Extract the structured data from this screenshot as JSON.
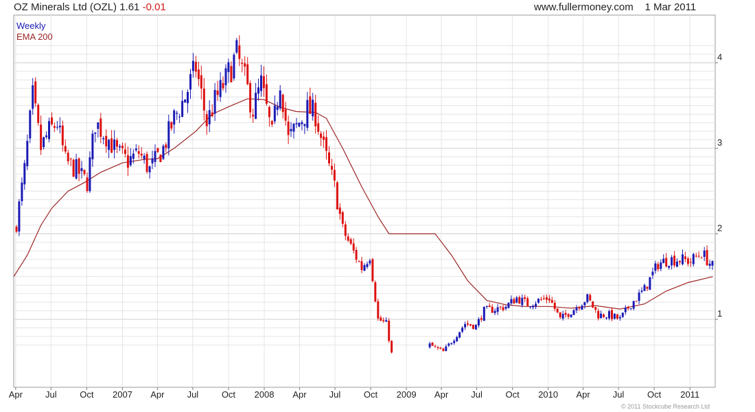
{
  "header": {
    "title": "OZ Minerals Ltd (OZL)",
    "price": "1.61",
    "change": "-0.01",
    "site": "www.fullermoney.com",
    "date": "1 Mar 2011"
  },
  "copyright": "© 2011 Stockcube Research Ltd",
  "colors": {
    "up": "#1a1ab4",
    "down": "#dd1111",
    "ema": "#9c2424",
    "grid": "#e4e4e4"
  },
  "chart_data": {
    "type": "candlestick",
    "interval": "Weekly",
    "series": [
      {
        "name": "Weekly",
        "kind": "candlestick",
        "anchors": [
          [
            "2006-04-03",
            2.12
          ],
          [
            "2006-04-24",
            2.75
          ],
          [
            "2006-05-15",
            3.6
          ],
          [
            "2006-06-05",
            3.0
          ],
          [
            "2006-06-26",
            3.2
          ],
          [
            "2006-07-17",
            3.3
          ],
          [
            "2006-08-07",
            2.85
          ],
          [
            "2006-09-04",
            2.75
          ],
          [
            "2006-10-02",
            2.6
          ],
          [
            "2006-10-23",
            3.3
          ],
          [
            "2006-11-20",
            3.15
          ],
          [
            "2006-12-18",
            2.95
          ],
          [
            "2007-01-15",
            2.85
          ],
          [
            "2007-02-12",
            2.95
          ],
          [
            "2007-03-12",
            2.75
          ],
          [
            "2007-04-16",
            3.0
          ],
          [
            "2007-05-14",
            3.35
          ],
          [
            "2007-06-11",
            3.6
          ],
          [
            "2007-07-09",
            3.95
          ],
          [
            "2007-08-06",
            3.3
          ],
          [
            "2007-08-27",
            3.55
          ],
          [
            "2007-09-24",
            3.8
          ],
          [
            "2007-10-22",
            4.1
          ],
          [
            "2007-11-12",
            3.8
          ],
          [
            "2007-12-03",
            3.45
          ],
          [
            "2007-12-24",
            3.75
          ],
          [
            "2008-01-21",
            3.15
          ],
          [
            "2008-02-11",
            3.8
          ],
          [
            "2008-03-03",
            3.1
          ],
          [
            "2008-03-24",
            3.25
          ],
          [
            "2008-04-21",
            3.45
          ],
          [
            "2008-05-12",
            3.4
          ],
          [
            "2008-06-02",
            3.0
          ],
          [
            "2008-06-30",
            2.55
          ],
          [
            "2008-07-21",
            2.05
          ],
          [
            "2008-08-11",
            1.85
          ],
          [
            "2008-09-08",
            1.6
          ],
          [
            "2008-09-29",
            1.75
          ],
          [
            "2008-10-20",
            1.0
          ],
          [
            "2008-11-10",
            0.95
          ],
          [
            "2008-11-24",
            0.6
          ]
        ]
      },
      {
        "name": "Weekly",
        "kind": "candlestick",
        "anchors": [
          [
            "2009-03-02",
            0.7
          ],
          [
            "2009-04-06",
            0.62
          ],
          [
            "2009-05-04",
            0.78
          ],
          [
            "2009-06-01",
            0.95
          ],
          [
            "2009-06-29",
            0.92
          ],
          [
            "2009-07-20",
            1.1
          ],
          [
            "2009-08-17",
            1.12
          ],
          [
            "2009-09-14",
            1.15
          ],
          [
            "2009-10-12",
            1.25
          ],
          [
            "2009-11-09",
            1.18
          ],
          [
            "2009-12-07",
            1.22
          ],
          [
            "2010-01-04",
            1.25
          ],
          [
            "2010-02-01",
            1.0
          ],
          [
            "2010-03-08",
            1.12
          ],
          [
            "2010-04-12",
            1.25
          ],
          [
            "2010-05-10",
            1.05
          ],
          [
            "2010-06-07",
            1.05
          ],
          [
            "2010-07-05",
            1.0
          ],
          [
            "2010-08-02",
            1.18
          ],
          [
            "2010-09-06",
            1.35
          ],
          [
            "2010-10-11",
            1.65
          ],
          [
            "2010-11-08",
            1.7
          ],
          [
            "2010-12-06",
            1.7
          ],
          [
            "2011-01-03",
            1.68
          ],
          [
            "2011-01-31",
            1.78
          ],
          [
            "2011-03-01",
            1.61
          ]
        ]
      },
      {
        "name": "EMA 200",
        "kind": "line",
        "anchors": [
          [
            "2006-03-27",
            1.5
          ],
          [
            "2006-05-01",
            1.75
          ],
          [
            "2006-06-05",
            2.1
          ],
          [
            "2006-07-03",
            2.3
          ],
          [
            "2006-08-14",
            2.5
          ],
          [
            "2006-09-25",
            2.6
          ],
          [
            "2006-11-06",
            2.72
          ],
          [
            "2007-01-01",
            2.83
          ],
          [
            "2007-02-26",
            2.87
          ],
          [
            "2007-04-02",
            2.88
          ],
          [
            "2007-05-14",
            3.0
          ],
          [
            "2007-07-09",
            3.2
          ],
          [
            "2007-08-20",
            3.4
          ],
          [
            "2007-10-08",
            3.5
          ],
          [
            "2007-11-19",
            3.58
          ],
          [
            "2007-12-31",
            3.57
          ],
          [
            "2008-02-11",
            3.48
          ],
          [
            "2008-03-24",
            3.43
          ],
          [
            "2008-05-12",
            3.42
          ],
          [
            "2008-06-09",
            3.35
          ],
          [
            "2008-07-21",
            3.0
          ],
          [
            "2008-09-08",
            2.55
          ],
          [
            "2008-10-20",
            2.2
          ],
          [
            "2008-11-17",
            2.0
          ],
          [
            "2009-03-16",
            2.0
          ],
          [
            "2009-04-27",
            1.75
          ],
          [
            "2009-06-08",
            1.45
          ],
          [
            "2009-07-27",
            1.22
          ],
          [
            "2009-09-14",
            1.17
          ],
          [
            "2009-11-02",
            1.15
          ],
          [
            "2010-01-04",
            1.15
          ],
          [
            "2010-03-01",
            1.13
          ],
          [
            "2010-05-03",
            1.16
          ],
          [
            "2010-07-05",
            1.12
          ],
          [
            "2010-09-06",
            1.18
          ],
          [
            "2010-11-01",
            1.33
          ],
          [
            "2010-12-27",
            1.43
          ],
          [
            "2011-03-01",
            1.5
          ]
        ]
      }
    ],
    "legend": [
      "Weekly",
      "EMA 200"
    ],
    "legend_position": "top-left",
    "yaxis_side": "right",
    "ylim": [
      0.6,
      4.3
    ],
    "y_ticks": [
      1,
      2,
      3,
      4
    ],
    "xlim": [
      "2006-03-27",
      "2011-03-07"
    ],
    "x_ticks": [
      [
        "2006-04-01",
        "Apr"
      ],
      [
        "2006-07-01",
        "Jul"
      ],
      [
        "2006-10-01",
        "Oct"
      ],
      [
        "2007-01-01",
        "2007"
      ],
      [
        "2007-04-01",
        "Apr"
      ],
      [
        "2007-07-01",
        "Jul"
      ],
      [
        "2007-10-01",
        "Oct"
      ],
      [
        "2008-01-01",
        "2008"
      ],
      [
        "2008-04-01",
        "Apr"
      ],
      [
        "2008-07-01",
        "Jul"
      ],
      [
        "2008-10-01",
        "Oct"
      ],
      [
        "2009-01-01",
        "2009"
      ],
      [
        "2009-04-01",
        "Apr"
      ],
      [
        "2009-07-01",
        "Jul"
      ],
      [
        "2009-10-01",
        "Oct"
      ],
      [
        "2010-01-01",
        "2010"
      ],
      [
        "2010-04-01",
        "Apr"
      ],
      [
        "2010-07-01",
        "Jul"
      ],
      [
        "2010-10-01",
        "Oct"
      ],
      [
        "2011-01-01",
        "2011"
      ]
    ],
    "grid": true
  }
}
